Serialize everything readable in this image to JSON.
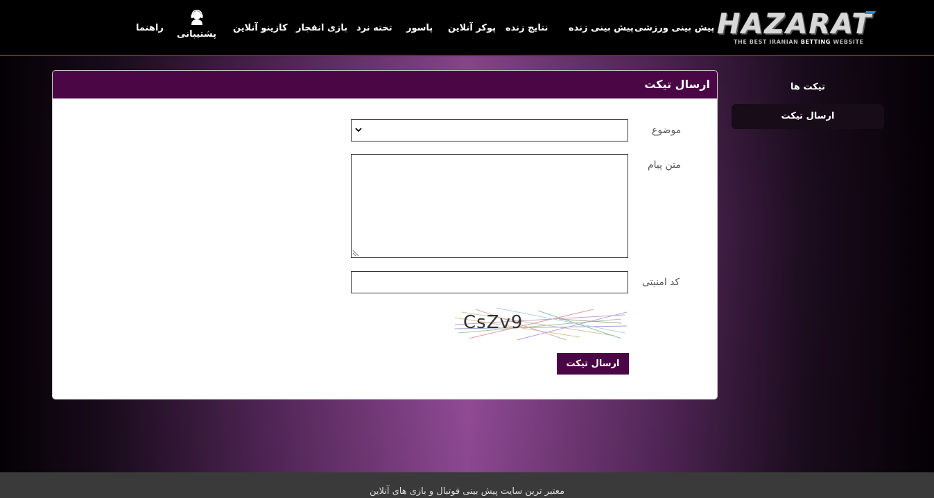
{
  "brand": {
    "logo_text": "HAZARAT",
    "tagline_pre": "THE BEST IRANIAN ",
    "tagline_bold": "BETTING",
    "tagline_post": " WEBSITE",
    "accent": "#1e90d8"
  },
  "nav": {
    "items": [
      {
        "label": "پیش بینی ورزشی"
      },
      {
        "label": "پیش بینی زنده"
      },
      {
        "label": "نتایج زنده"
      },
      {
        "label": "پوکر آنلاین"
      },
      {
        "label": "پاسور"
      },
      {
        "label": "تخته نرد"
      },
      {
        "label": "بازی انفجار"
      },
      {
        "label": "کازینو آنلاین"
      }
    ],
    "support_label": "پشتیبانی",
    "guide_label": "راهنما"
  },
  "sidebar": {
    "title": "تیکت ها",
    "active_item": "ارسال تیکت"
  },
  "panel": {
    "title": "ارسال تیکت",
    "subject_label": "موضوع",
    "subject_value": "",
    "message_label": "متن پیام",
    "message_value": "",
    "captcha_label": "کد امنیتی",
    "captcha_value": "",
    "captcha_image_text": "CsZv9",
    "submit_label": "ارسال تیکت"
  },
  "footer": {
    "text": "معتبر ترین سایت پیش بینی فوتبال و بازی های آنلاین"
  },
  "colors": {
    "header_bg": "#000000",
    "panel_header": "#4b0645",
    "glow": "#9b50a0",
    "footer_bg": "#3a3a3a"
  }
}
